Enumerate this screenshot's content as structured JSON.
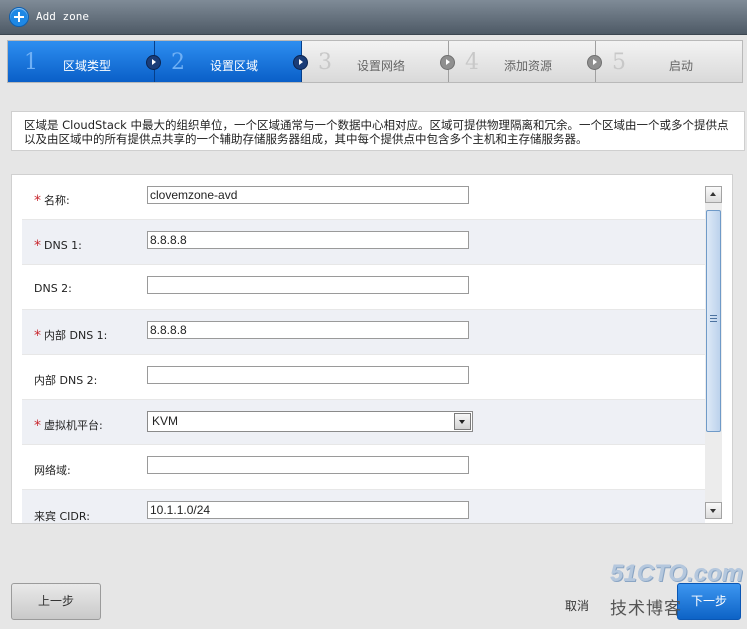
{
  "window": {
    "title": "Add zone",
    "icon": "add-circle-icon"
  },
  "steps": [
    {
      "num": "1",
      "label": "区域类型",
      "state": "done"
    },
    {
      "num": "2",
      "label": "设置区域",
      "state": "active"
    },
    {
      "num": "3",
      "label": "设置网络",
      "state": "pending"
    },
    {
      "num": "4",
      "label": "添加资源",
      "state": "pending"
    },
    {
      "num": "5",
      "label": "启动",
      "state": "pending"
    }
  ],
  "description": "区域是 CloudStack 中最大的组织单位，一个区域通常与一个数据中心相对应。区域可提供物理隔离和冗余。一个区域由一个或多个提供点以及由区域中的所有提供点共享的一个辅助存储服务器组成，其中每个提供点中包含多个主机和主存储服务器。",
  "form": {
    "rows": [
      {
        "label": "名称:",
        "required": true,
        "value": "clovemzone-avd"
      },
      {
        "label": "DNS 1:",
        "required": true,
        "value": "8.8.8.8"
      },
      {
        "label": "DNS 2:",
        "required": false,
        "value": ""
      },
      {
        "label": "内部 DNS 1:",
        "required": true,
        "value": "8.8.8.8"
      },
      {
        "label": "内部 DNS 2:",
        "required": false,
        "value": ""
      },
      {
        "label": "虚拟机平台:",
        "required": true,
        "value": "KVM",
        "type": "select"
      },
      {
        "label": "网络域:",
        "required": false,
        "value": ""
      },
      {
        "label": "来宾 CIDR:",
        "required": false,
        "value": "10.1.1.0/24"
      }
    ],
    "required_mark": "*"
  },
  "footer": {
    "prev_label": "上一步",
    "cancel_label": "取消",
    "next_label": "下一步"
  },
  "watermark": {
    "line1": "51CTO.com",
    "line2": "技术博客"
  },
  "colors": {
    "accent": "#0a6be0",
    "required": "#c8282f",
    "titlebar": "#5f6b77"
  }
}
